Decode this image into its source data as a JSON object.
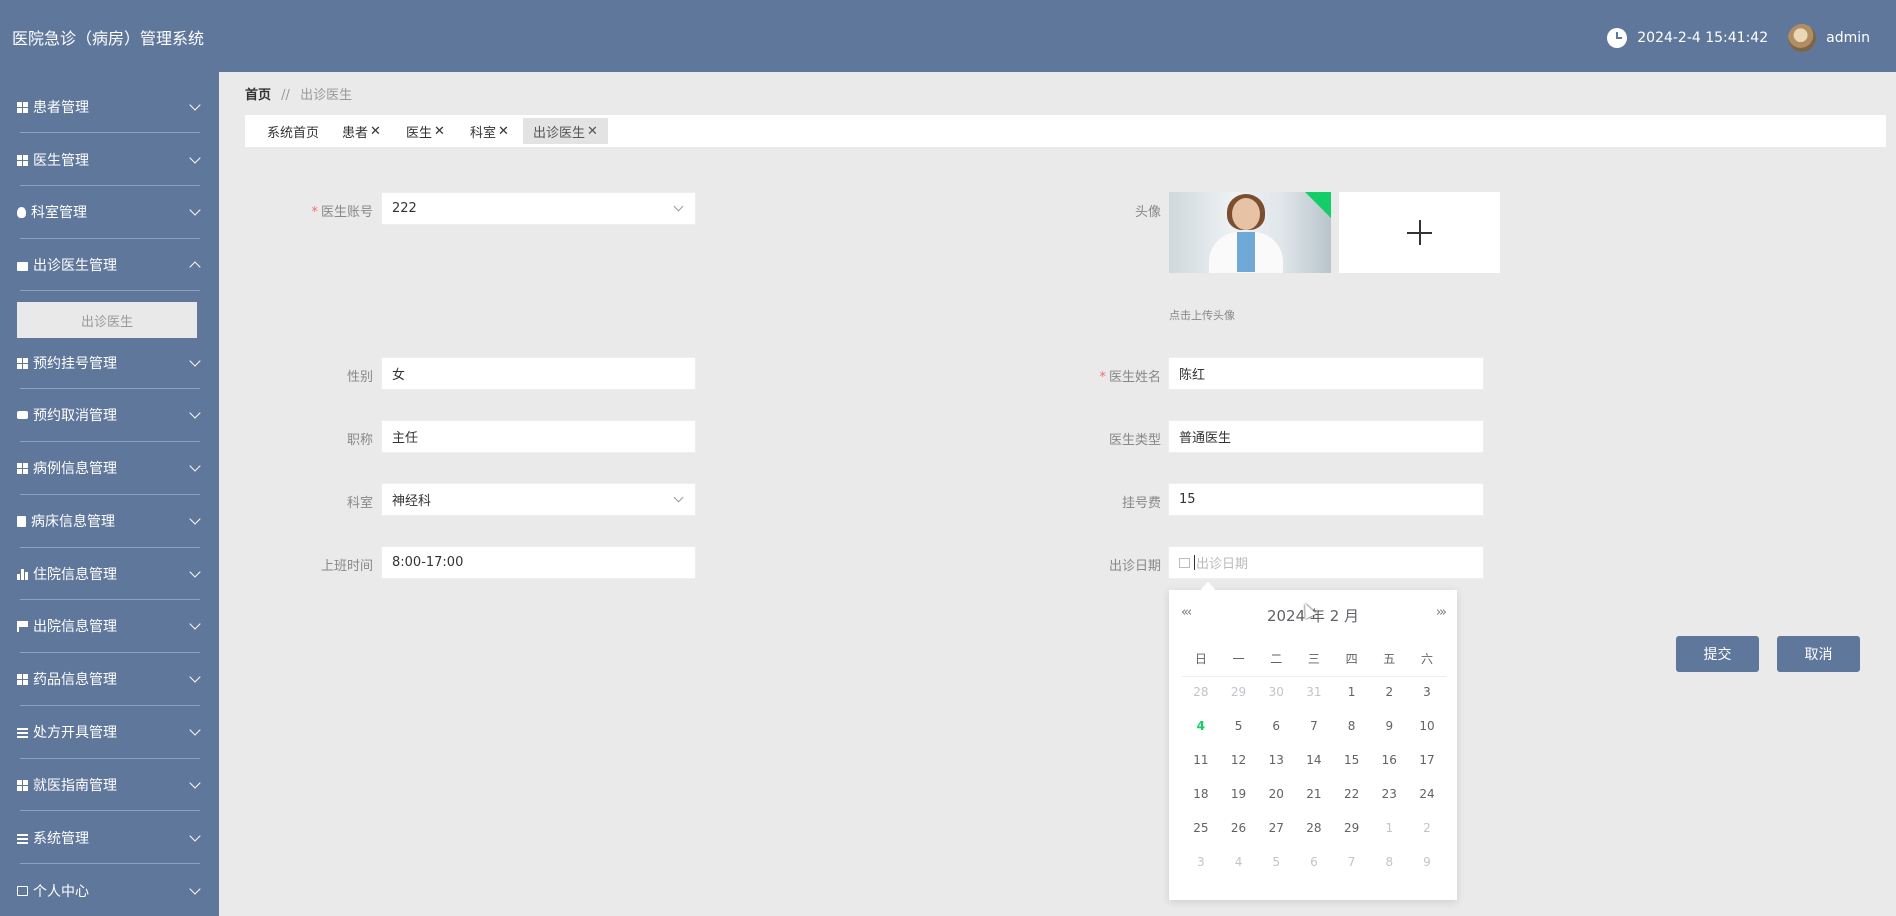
{
  "header": {
    "app_title": "医院急诊（病房）管理系统",
    "datetime": "2024-2-4 15:41:42",
    "username": "admin"
  },
  "sidebar": {
    "items": [
      {
        "label": "患者管理",
        "icon": "grid-icon"
      },
      {
        "label": "医生管理",
        "icon": "grid-icon"
      },
      {
        "label": "科室管理",
        "icon": "bulb-icon"
      },
      {
        "label": "出诊医生管理",
        "icon": "briefcase-icon",
        "expanded": true,
        "sub": [
          "出诊医生"
        ]
      },
      {
        "label": "预约挂号管理",
        "icon": "grid-icon"
      },
      {
        "label": "预约取消管理",
        "icon": "chat-icon"
      },
      {
        "label": "病例信息管理",
        "icon": "grid-icon"
      },
      {
        "label": "病床信息管理",
        "icon": "clipboard-icon"
      },
      {
        "label": "住院信息管理",
        "icon": "bar-chart-icon"
      },
      {
        "label": "出院信息管理",
        "icon": "flag-icon"
      },
      {
        "label": "药品信息管理",
        "icon": "grid-icon"
      },
      {
        "label": "处方开具管理",
        "icon": "sliders-icon"
      },
      {
        "label": "就医指南管理",
        "icon": "grid-icon"
      },
      {
        "label": "系统管理",
        "icon": "list-icon"
      },
      {
        "label": "个人中心",
        "icon": "card-icon"
      }
    ]
  },
  "breadcrumb": {
    "home": "首页",
    "separator": "//",
    "current": "出诊医生"
  },
  "tabs": [
    {
      "label": "系统首页",
      "closable": false
    },
    {
      "label": "患者",
      "closable": true
    },
    {
      "label": "医生",
      "closable": true
    },
    {
      "label": "科室",
      "closable": true
    },
    {
      "label": "出诊医生",
      "closable": true,
      "active": true
    }
  ],
  "form": {
    "doctor_account": {
      "label": "医生账号",
      "value": "222",
      "required": true
    },
    "avatar": {
      "label": "头像",
      "hint": "点击上传头像"
    },
    "gender": {
      "label": "性别",
      "value": "女"
    },
    "doctor_name": {
      "label": "医生姓名",
      "value": "陈红",
      "required": true
    },
    "title": {
      "label": "职称",
      "value": "主任"
    },
    "doctor_type": {
      "label": "医生类型",
      "value": "普通医生"
    },
    "department": {
      "label": "科室",
      "value": "神经科"
    },
    "fee": {
      "label": "挂号费",
      "value": "15"
    },
    "work_time": {
      "label": "上班时间",
      "value": "8:00-17:00"
    },
    "visit_date": {
      "label": "出诊日期",
      "placeholder": "出诊日期"
    }
  },
  "datepicker": {
    "year": "2024 年",
    "month": "2 月",
    "weekdays": [
      "日",
      "一",
      "二",
      "三",
      "四",
      "五",
      "六"
    ],
    "weeks": [
      [
        [
          "28",
          "other"
        ],
        [
          "29",
          "other"
        ],
        [
          "30",
          "other"
        ],
        [
          "31",
          "other"
        ],
        [
          "1",
          ""
        ],
        [
          "2",
          ""
        ],
        [
          "3",
          ""
        ]
      ],
      [
        [
          "4",
          "today"
        ],
        [
          "5",
          ""
        ],
        [
          "6",
          ""
        ],
        [
          "7",
          ""
        ],
        [
          "8",
          ""
        ],
        [
          "9",
          ""
        ],
        [
          "10",
          ""
        ]
      ],
      [
        [
          "11",
          ""
        ],
        [
          "12",
          ""
        ],
        [
          "13",
          ""
        ],
        [
          "14",
          ""
        ],
        [
          "15",
          ""
        ],
        [
          "16",
          ""
        ],
        [
          "17",
          ""
        ]
      ],
      [
        [
          "18",
          ""
        ],
        [
          "19",
          ""
        ],
        [
          "20",
          ""
        ],
        [
          "21",
          ""
        ],
        [
          "22",
          ""
        ],
        [
          "23",
          ""
        ],
        [
          "24",
          ""
        ]
      ],
      [
        [
          "25",
          ""
        ],
        [
          "26",
          ""
        ],
        [
          "27",
          ""
        ],
        [
          "28",
          ""
        ],
        [
          "29",
          ""
        ],
        [
          "1",
          "other"
        ],
        [
          "2",
          "other"
        ]
      ],
      [
        [
          "3",
          "other"
        ],
        [
          "4",
          "other"
        ],
        [
          "5",
          "other"
        ],
        [
          "6",
          "other"
        ],
        [
          "7",
          "other"
        ],
        [
          "8",
          "other"
        ],
        [
          "9",
          "other"
        ]
      ]
    ]
  },
  "buttons": {
    "submit": "提交",
    "cancel": "取消"
  },
  "colors": {
    "primary": "#60779c",
    "today": "#13ce66",
    "required": "#f56c6c"
  }
}
